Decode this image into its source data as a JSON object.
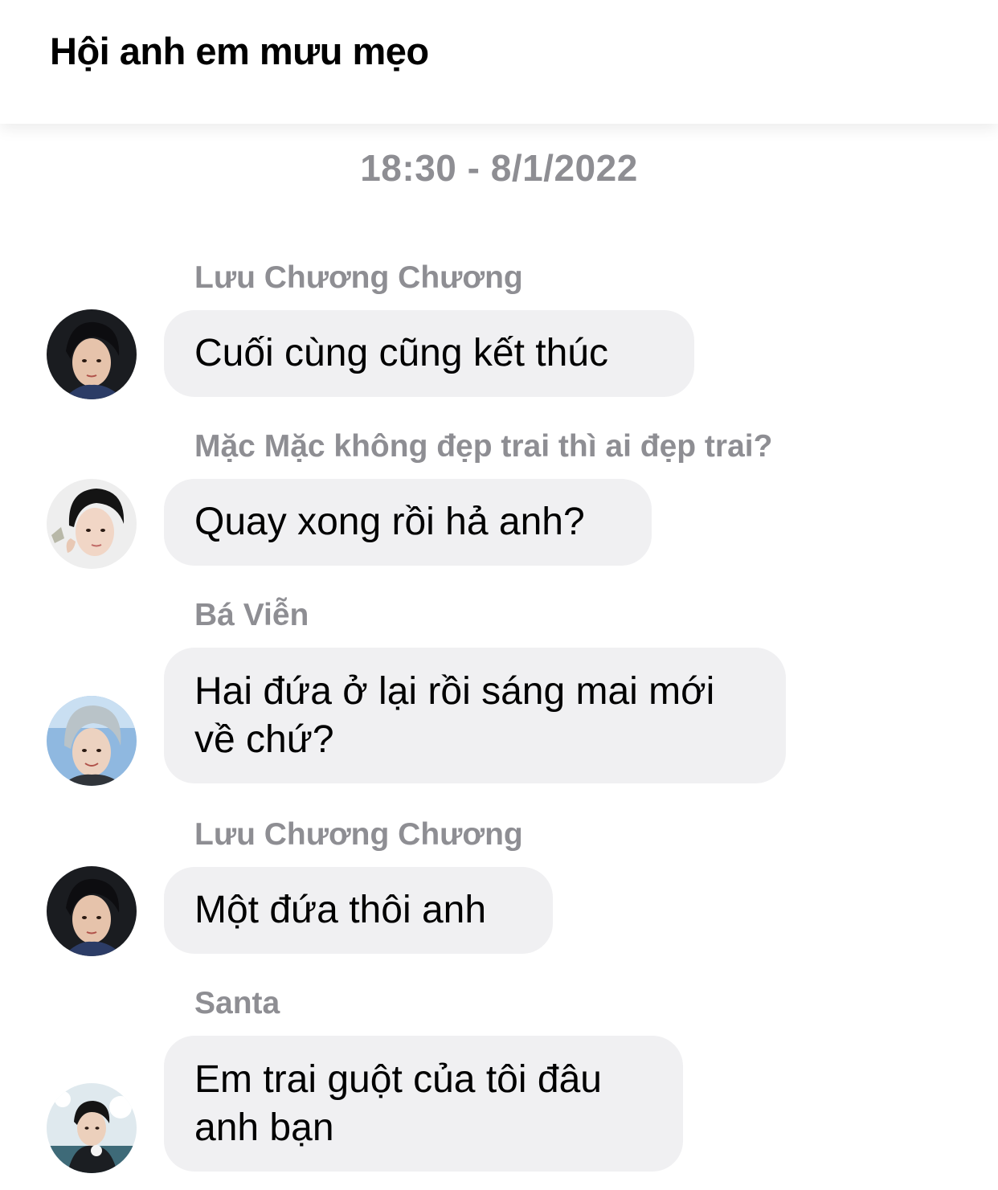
{
  "header": {
    "title": "Hội anh em mưu mẹo"
  },
  "timestamp": "18:30 - 8/1/2022",
  "messages": [
    {
      "sender": "Lưu Chương Chương",
      "text": "Cuối cùng cũng kết thúc",
      "avatar": "avatar-dark-hair-icon"
    },
    {
      "sender": "Mặc Mặc không đẹp trai thì ai đẹp trai?",
      "text": "Quay xong rồi hả anh?",
      "avatar": "avatar-light-portrait-icon"
    },
    {
      "sender": "Bá Viễn",
      "text": "Hai đứa ở lại rồi sáng mai mới về chứ?",
      "text_lines": [
        "Hai đứa ở lại rồi sáng mai mới",
        "về chứ?"
      ],
      "avatar": "avatar-silver-hair-icon"
    },
    {
      "sender": "Lưu Chương Chương",
      "text": "Một đứa thôi anh",
      "avatar": "avatar-dark-hair-icon"
    },
    {
      "sender": "Santa",
      "text": "Em trai guột của tôi đâu anh bạn",
      "text_lines": [
        "Em trai guột của tôi đâu",
        "anh bạn"
      ],
      "avatar": "avatar-snow-portrait-icon"
    }
  ],
  "colors": {
    "bubble": "#f0f0f2",
    "secondary_text": "#8e8e93",
    "primary_text": "#000000"
  }
}
